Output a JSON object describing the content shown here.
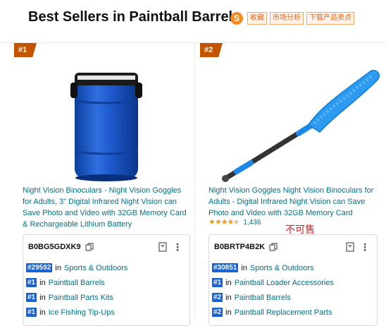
{
  "page": {
    "title": "Best Sellers in Paintball Barrels"
  },
  "toolbar": {
    "logo_letter": "S",
    "buttons": [
      "收藏",
      "市场分析",
      "下载产品卖点"
    ]
  },
  "products": [
    {
      "rank": "#1",
      "image_icon": "blue-barrel-image",
      "title": "Night Vision Binoculars - Night Vision Goggles for Adults, 3\" Digital Infrared Night Vision can Save Photo and Video with 32GB Memory Card & Rechargeable Lithium Battery",
      "asin": "B0BG5GDXK9",
      "category_ranks": [
        {
          "rank": "#29592",
          "category": "Sports & Outdoors",
          "wide": true
        },
        {
          "rank": "#1",
          "category": "Paintball Barrels"
        },
        {
          "rank": "#1",
          "category": "Paintball Parts Kits"
        },
        {
          "rank": "#1",
          "category": "Ice Fishing Tip-Ups"
        }
      ]
    },
    {
      "rank": "#2",
      "image_icon": "barrel-squeegee-image",
      "title": "Night Vision Goggles Night Vision Binoculars for Adults - Digital Infrared Night Vision can Save Photo and Video with 32GB Memory Card",
      "rating": {
        "stars": 4.5,
        "count": "1,436"
      },
      "availability": "不可售",
      "asin": "B0BRTP4B2K",
      "category_ranks": [
        {
          "rank": "#30851",
          "category": "Sports & Outdoors",
          "wide": true
        },
        {
          "rank": "#1",
          "category": "Paintball Loader Accessories"
        },
        {
          "rank": "#2",
          "category": "Paintball Barrels"
        },
        {
          "rank": "#2",
          "category": "Paintball Replacement Parts"
        }
      ]
    }
  ],
  "colors": {
    "rank_badge": "#c45500",
    "link": "#007185",
    "rank_tag": "#1861d6",
    "unavailable": "#e31b23",
    "star": "#f39c12"
  }
}
